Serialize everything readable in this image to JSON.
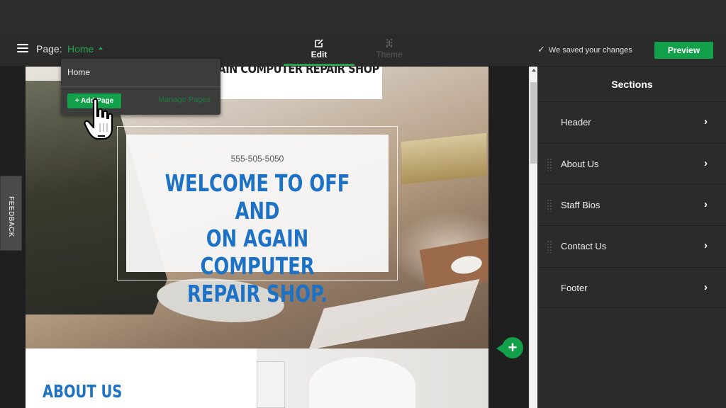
{
  "toolbar": {
    "page_label": "Page:",
    "current_page": "Home",
    "tabs": [
      {
        "label": "Edit",
        "icon": "edit-icon",
        "active": true
      },
      {
        "label": "Theme",
        "icon": "theme-icon",
        "active": false
      }
    ],
    "save_status": "We saved your changes",
    "preview_label": "Preview"
  },
  "page_dropdown": {
    "items": [
      "Home"
    ],
    "add_page_label": "+ Add Page",
    "manage_pages_label": "Manage Pages"
  },
  "feedback_label": "FEEDBACK",
  "site": {
    "title": "OFF AND ON AGAIN COMPUTER REPAIR SHOP",
    "title_visible": "GAIN COMPUTER REPAIR SHOP",
    "phone": "555-505-5050",
    "hero_heading": "WELCOME TO OFF AND\nON AGAIN COMPUTER\nREPAIR SHOP.",
    "about_heading": "ABOUT US"
  },
  "sections_panel": {
    "title": "Sections",
    "items": [
      {
        "label": "Header",
        "draggable": false
      },
      {
        "label": "About Us",
        "draggable": true
      },
      {
        "label": "Staff Bios",
        "draggable": true
      },
      {
        "label": "Contact Us",
        "draggable": true
      },
      {
        "label": "Footer",
        "draggable": false
      }
    ]
  },
  "colors": {
    "accent_green": "#13a04a",
    "heading_blue": "#1e72c5",
    "toolbar_bg": "#2b2b2b"
  }
}
